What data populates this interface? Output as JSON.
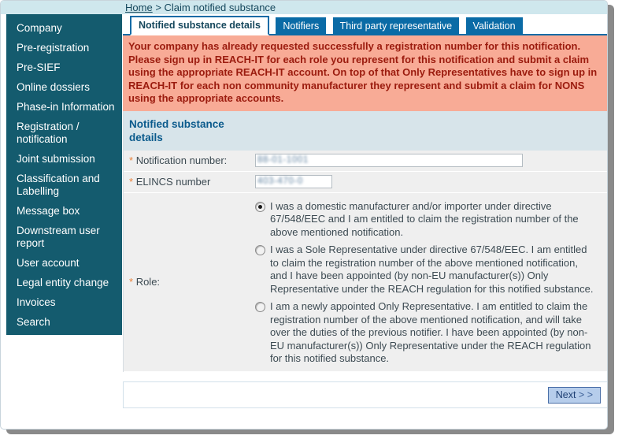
{
  "breadcrumb": {
    "home": "Home",
    "separator": ">",
    "current": "Claim notified substance"
  },
  "sidebar": {
    "items": [
      {
        "label": "Company"
      },
      {
        "label": "Pre-registration"
      },
      {
        "label": "Pre-SIEF"
      },
      {
        "label": "Online dossiers"
      },
      {
        "label": "Phase-in Information"
      },
      {
        "label": "Registration / notification"
      },
      {
        "label": "Joint submission"
      },
      {
        "label": "Classification and Labelling"
      },
      {
        "label": "Message box"
      },
      {
        "label": "Downstream user report"
      },
      {
        "label": "User account"
      },
      {
        "label": "Legal entity change"
      },
      {
        "label": "Invoices"
      },
      {
        "label": "Search"
      }
    ]
  },
  "tabs": [
    {
      "label": "Notified substance details",
      "active": true
    },
    {
      "label": "Notifiers",
      "active": false
    },
    {
      "label": "Third party representative",
      "active": false
    },
    {
      "label": "Validation",
      "active": false
    }
  ],
  "alert": {
    "text": "Your company has already requested successfully a registration number for this notification. Please sign up in REACH-IT for each role you represent for this notification and submit a claim using the appropriate REACH-IT account. On top of that Only Representatives have to sign up in REACH-IT for each non community manufacturer they represent and submit a claim for NONS using the appropriate accounts."
  },
  "section": {
    "title": "Notified substance details"
  },
  "form": {
    "required_marker": "*",
    "notification_number": {
      "label": "Notification number:",
      "value": "88-01-1001",
      "placeholder": ""
    },
    "elincs_number": {
      "label": "ELINCS number",
      "value": "403-470-0",
      "placeholder": ""
    },
    "role": {
      "label": "Role:",
      "options": [
        {
          "text": "I was a domestic manufacturer and/or importer under directive 67/548/EEC and I am entitled to claim the registration number of the above mentioned notification.",
          "selected": true
        },
        {
          "text": "I was a Sole Representative under directive 67/548/EEC. I am entitled to claim the registration number of the above mentioned notification, and I have been appointed (by non-EU manufacturer(s)) Only Representative under the REACH regulation for this notified substance.",
          "selected": false
        },
        {
          "text": "I am a newly appointed Only Representative. I am entitled to claim the registration number of the above mentioned notification, and will take over the duties of the previous notifier. I have been appointed (by non-EU manufacturer(s)) Only Representative under the REACH regulation for this notified substance.",
          "selected": false
        }
      ]
    }
  },
  "footer": {
    "next_label": "Next",
    "next_arrows": "> >"
  },
  "colors": {
    "sidebar_bg": "#145b6e",
    "breadcrumb_bg": "#cfe7ed",
    "tab_active_border": "#0a6ba6",
    "tab_inactive_bg": "#0a6ba6",
    "alert_bg": "#f8ab96",
    "alert_text": "#9b1b0e",
    "section_header_bg": "#d7e4ea",
    "section_header_text": "#0a5a8c",
    "required_star": "#e8823c",
    "button_bg": "#b6cdeb"
  }
}
